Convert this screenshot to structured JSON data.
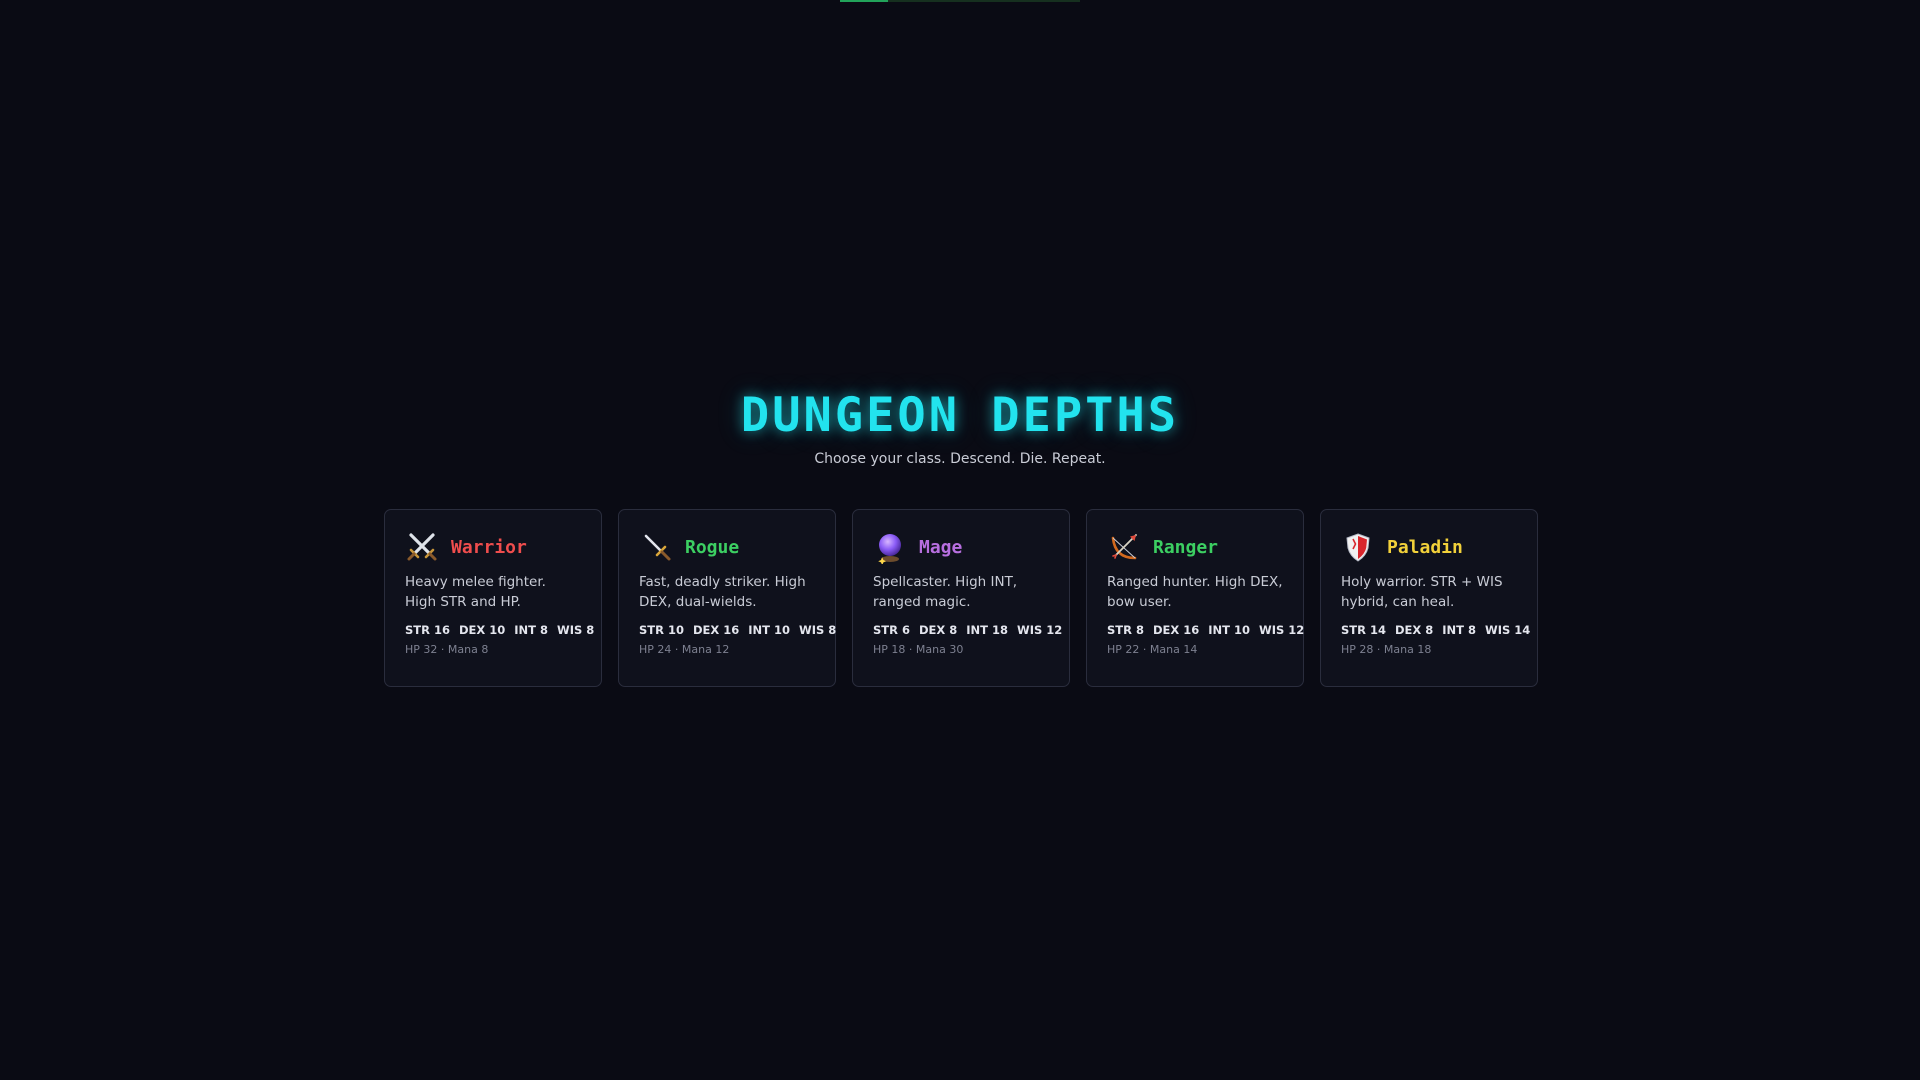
{
  "header": {
    "title": "DUNGEON DEPTHS",
    "subtitle": "Choose your class. Descend. Die. Repeat."
  },
  "loading": {
    "progress": 0.2
  },
  "classes": [
    {
      "name": "Warrior",
      "icon": "crossed-swords-icon",
      "color": "#ef4d4d",
      "desc": "Heavy melee fighter. High STR and HP.",
      "stats": [
        "STR 16",
        "DEX 10",
        "INT 8",
        "WIS 8"
      ],
      "resources": "HP 32 · Mana 8"
    },
    {
      "name": "Rogue",
      "icon": "dagger-icon",
      "color": "#3ccf62",
      "desc": "Fast, deadly striker. High DEX, dual-wields.",
      "stats": [
        "STR 10",
        "DEX 16",
        "INT 10",
        "WIS 8"
      ],
      "resources": "HP 24 · Mana 12"
    },
    {
      "name": "Mage",
      "icon": "crystal-ball-icon",
      "color": "#b86fe0",
      "desc": "Spellcaster. High INT, ranged magic.",
      "stats": [
        "STR 6",
        "DEX 8",
        "INT 18",
        "WIS 12"
      ],
      "resources": "HP 18 · Mana 30"
    },
    {
      "name": "Ranger",
      "icon": "bow-and-arrow-icon",
      "color": "#3ccf62",
      "desc": "Ranged hunter. High DEX, bow user.",
      "stats": [
        "STR 8",
        "DEX 16",
        "INT 10",
        "WIS 12"
      ],
      "resources": "HP 22 · Mana 14"
    },
    {
      "name": "Paladin",
      "icon": "shield-icon",
      "color": "#f2d13a",
      "desc": "Holy warrior. STR + WIS hybrid, can heal.",
      "stats": [
        "STR 14",
        "DEX 8",
        "INT 8",
        "WIS 14"
      ],
      "resources": "HP 28 · Mana 18"
    }
  ]
}
